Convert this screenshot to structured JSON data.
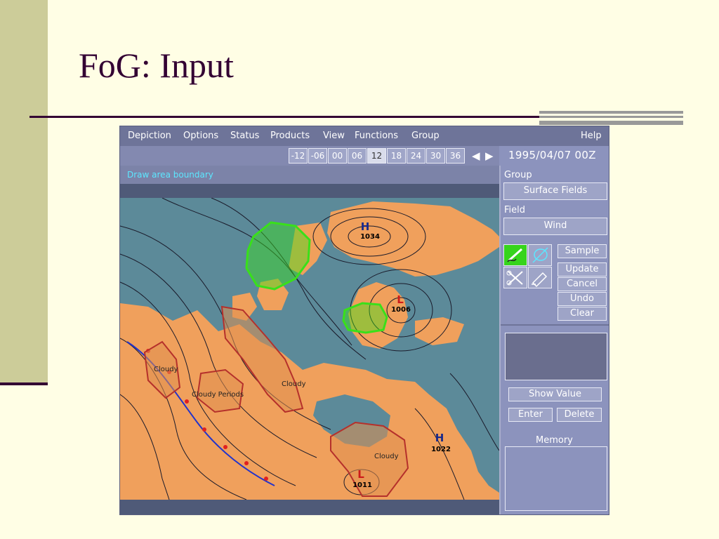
{
  "slide": {
    "title": "FoG: Input"
  },
  "menubar": {
    "items": [
      "Depiction",
      "Options",
      "Status",
      "Products",
      "View",
      "Functions",
      "Group"
    ],
    "help": "Help"
  },
  "hours": [
    "-12",
    "-06",
    "00",
    "06",
    "12",
    "18",
    "24",
    "30",
    "36"
  ],
  "hours_selected": "12",
  "datetime": "1995/04/07 00Z",
  "status_message": "Draw area boundary",
  "panel": {
    "group_label": "Group",
    "group_value": "Surface Fields",
    "field_label": "Field",
    "field_value": "Wind",
    "buttons": {
      "sample": "Sample",
      "update": "Update",
      "cancel": "Cancel",
      "undo": "Undo",
      "clear": "Clear"
    },
    "show_value": "Show Value",
    "enter": "Enter",
    "delete": "Delete",
    "memory_label": "Memory"
  },
  "map": {
    "pressure_centers": [
      {
        "type": "H",
        "value": "1034"
      },
      {
        "type": "L",
        "value": "1006"
      },
      {
        "type": "H",
        "value": "1022"
      },
      {
        "type": "L",
        "value": "1011"
      }
    ],
    "area_labels": [
      "Cloudy",
      "Cloudy Periods",
      "Cloudy",
      "Cloudy"
    ]
  },
  "colors": {
    "ocean": "#5C8A99",
    "land": "#F0A05C",
    "draw_area": "#39E01A",
    "cloud_area": "#B5302B",
    "status_text": "#5CE7FF"
  }
}
